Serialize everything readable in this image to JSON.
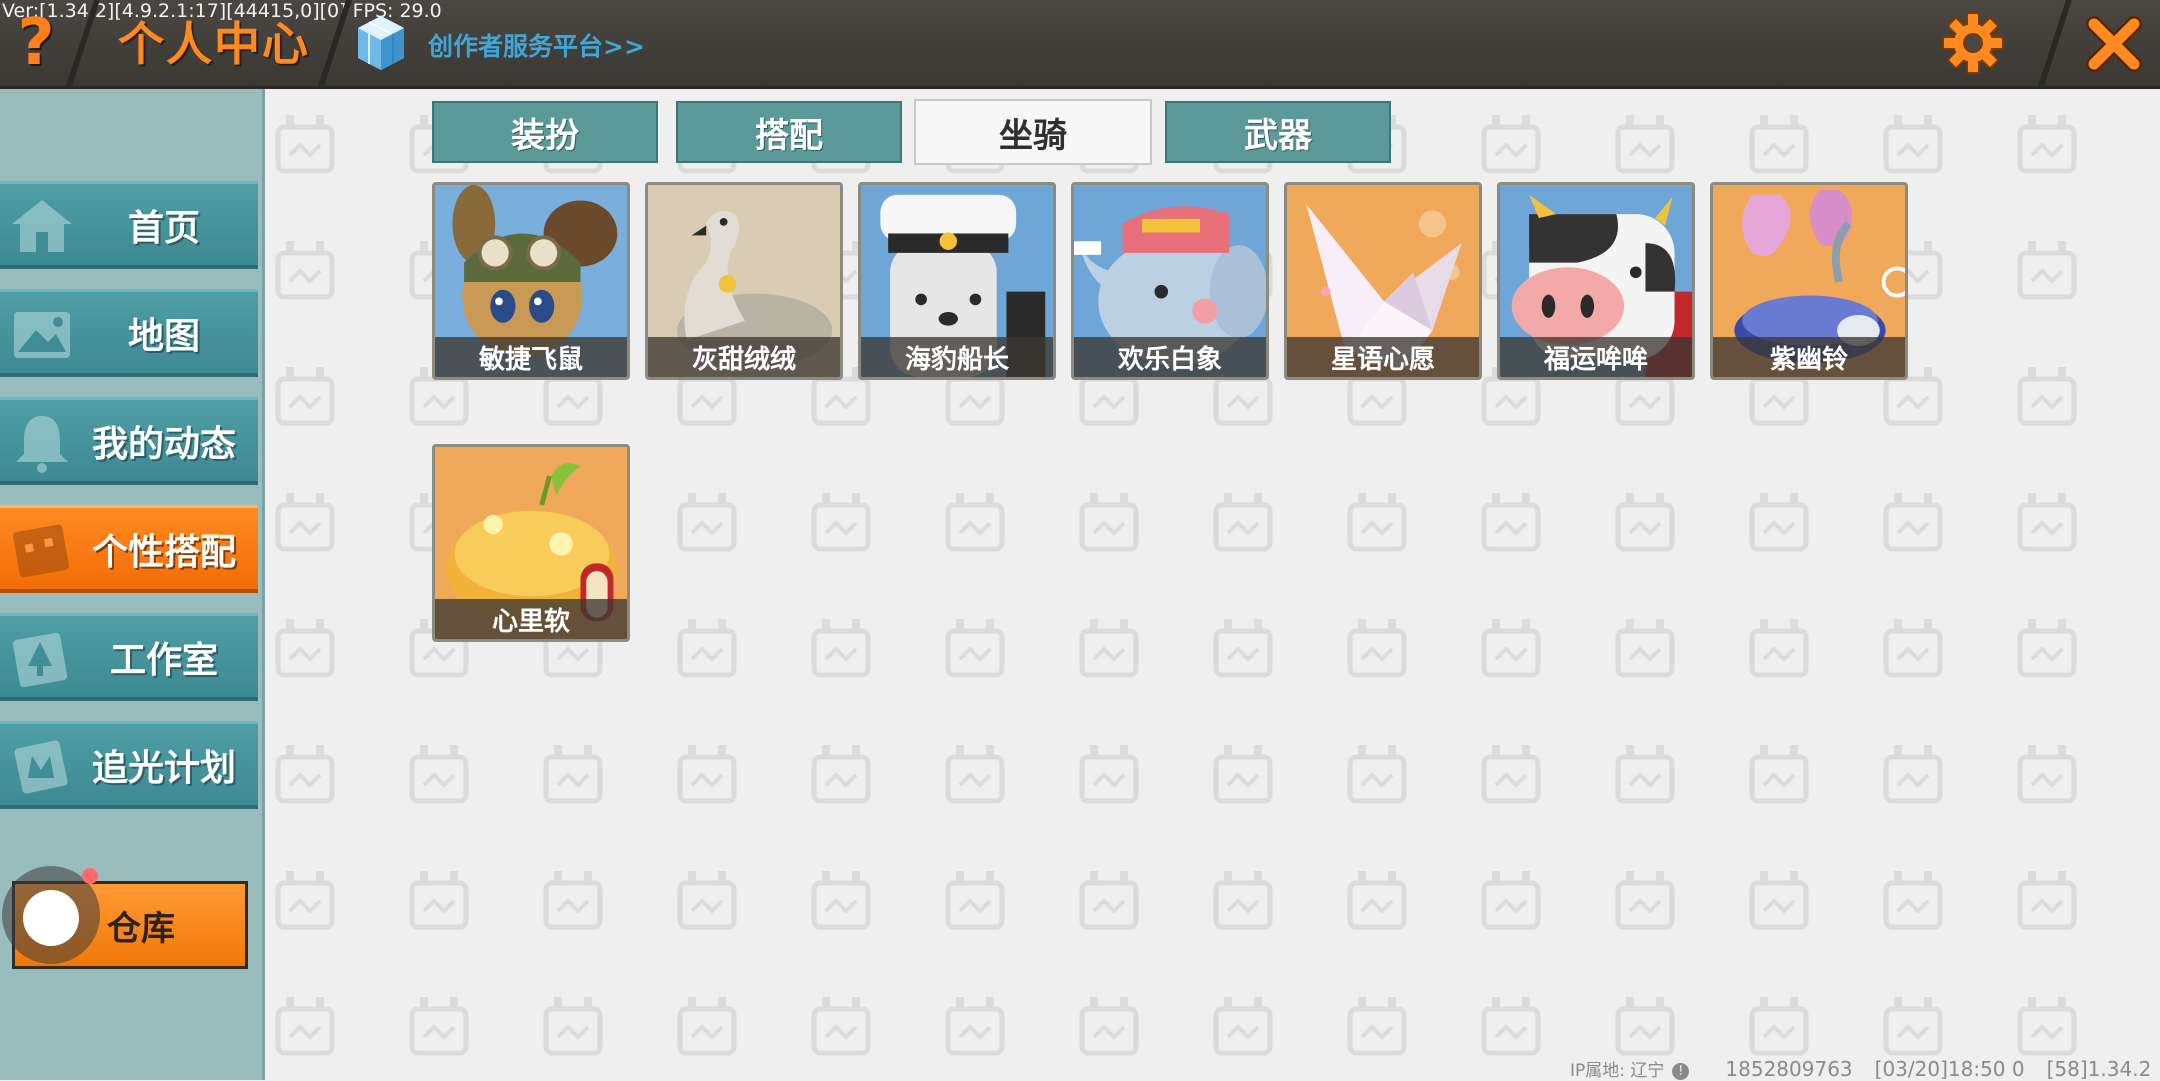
{
  "header": {
    "version_text": "Ver:[1.34.2][4.9.2.1:17][44415,0][0] FPS: 29.0",
    "help_glyph": "?",
    "title": "个人中心",
    "creator_link": "创作者服务平台>>",
    "accent_color": "#ff8a22",
    "link_color": "#3fa6d6"
  },
  "sidebar": {
    "items": [
      {
        "label": "首页",
        "icon": "house-icon"
      },
      {
        "label": "地图",
        "icon": "map-icon"
      },
      {
        "label": "我的动态",
        "icon": "bell-icon"
      },
      {
        "label": "个性搭配",
        "icon": "wardrobe-icon",
        "active": true
      },
      {
        "label": "工作室",
        "icon": "studio-icon"
      },
      {
        "label": "追光计划",
        "icon": "badge-icon"
      }
    ],
    "warehouse_label": "仓库"
  },
  "tabs": [
    {
      "label": "装扮"
    },
    {
      "label": "搭配"
    },
    {
      "label": "坐骑",
      "active": true
    },
    {
      "label": "武器"
    }
  ],
  "items": [
    {
      "name": "敏捷飞鼠",
      "bg": "#6fa6d8"
    },
    {
      "name": "灰甜绒绒",
      "bg": "#d8cdb4"
    },
    {
      "name": "海豹船长",
      "bg": "#6fa6d8"
    },
    {
      "name": "欢乐白象",
      "bg": "#6fa6d8"
    },
    {
      "name": "星语心愿",
      "bg": "#f0a85a"
    },
    {
      "name": "福运哞哞",
      "bg": "#6fa6d8"
    },
    {
      "name": "紫幽铃",
      "bg": "#f0a85a"
    },
    {
      "name": "心里软",
      "bg": "#f0a85a"
    }
  ],
  "footer": {
    "ip_label": "IP属地: 辽宁",
    "info_glyph": "!",
    "uid": "1852809763",
    "time": "[03/20]18:50 0",
    "build": "[58]1.34.2"
  }
}
